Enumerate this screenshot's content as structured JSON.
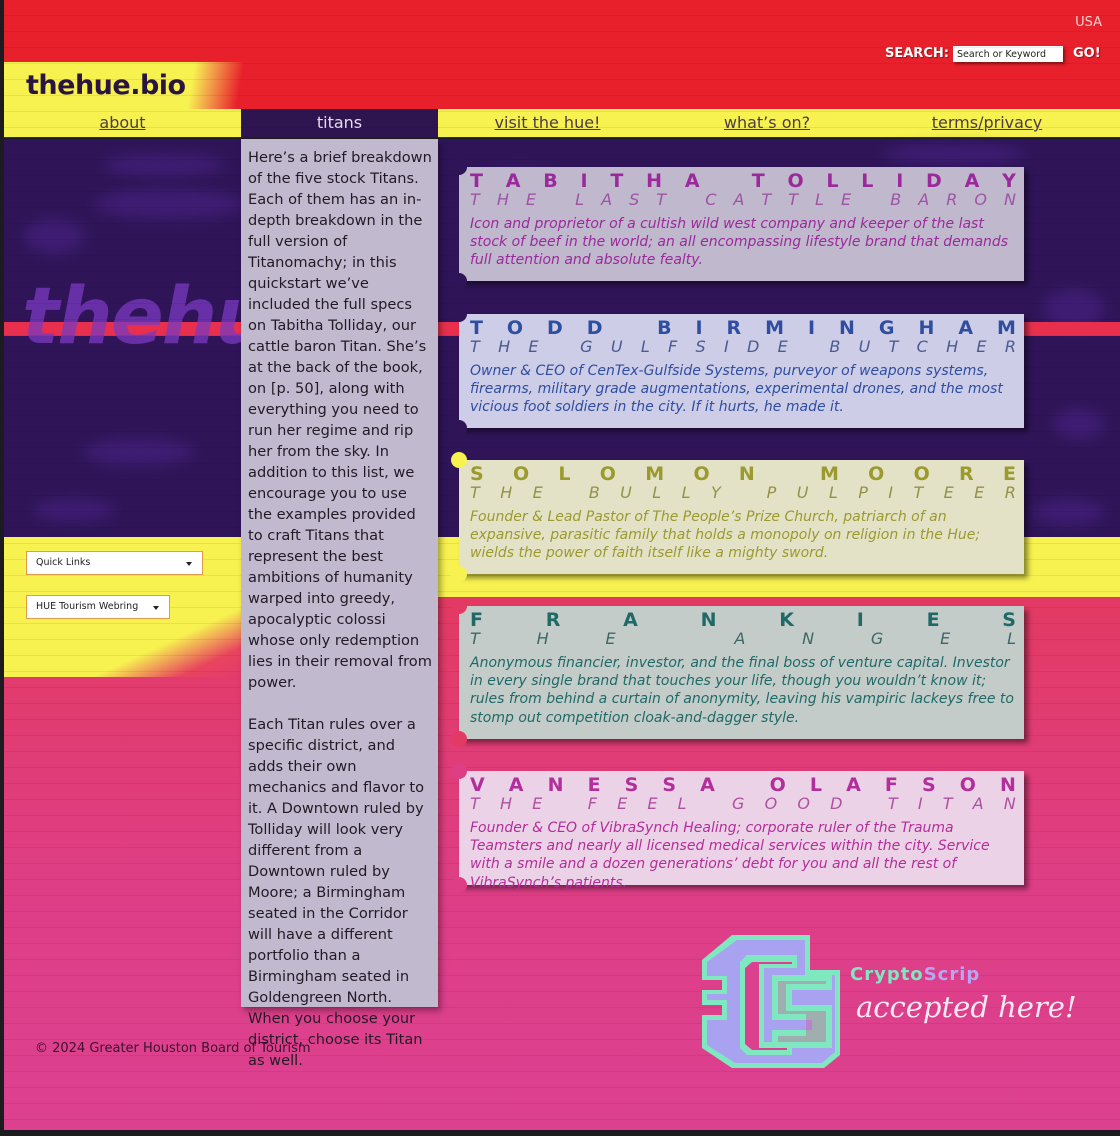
{
  "header": {
    "site_logo": "thehue.bio",
    "region": "USA",
    "search_label": "SEARCH:",
    "search_placeholder": "Search or Keyword",
    "search_value": "",
    "go_label": "GO!"
  },
  "nav": {
    "items": [
      {
        "label": "about",
        "active": false
      },
      {
        "label": "titans",
        "active": true
      },
      {
        "label": "visit the hue!",
        "active": false
      },
      {
        "label": "what’s on?",
        "active": false
      },
      {
        "label": "terms/privacy",
        "active": false
      }
    ]
  },
  "background_watermark": "thehue",
  "sidebar": {
    "quick_links": "Quick Links",
    "webring": "HUE Tourism Webring"
  },
  "intro": {
    "paragraphs": [
      "Here’s a brief breakdown of the five stock Titans. Each of them has an in-depth breakdown in the full version of Titanomachy; in this quickstart we’ve included the full specs on Tabitha Tolliday, our cattle baron Titan. She’s at the back of the book, on [p. 50], along with everything you need to run her regime and rip her from the sky. In addition to this list, we encourage you to use the examples provided to craft Titans that represent the best ambitions of humanity warped into greedy, apocalyptic colossi whose only redemption lies in their removal from power.",
      "Each Titan rules over a specific district, and adds their own mechanics and flavor to it. A Downtown ruled by Tolliday will look very different from a Downtown ruled by Moore; a Birmingham seated in the Corridor will have a different portfolio than a Birmingham seated in Goldengreen North. When you choose your district, choose its Titan as well."
    ]
  },
  "titans": [
    {
      "name": "TABITHA TOLLIDAY",
      "title": "THE LAST CATTLE BARON",
      "description": "Icon and proprietor of a cultish wild west company and keeper of the last stock of beef in the world; an all encompassing lifestyle brand that demands full attention and absolute fealty.",
      "bg": "#c0b8cc",
      "color": "#9a2a9c",
      "title_color": "#9a4aa0"
    },
    {
      "name": "TODD BIRMINGHAM",
      "title": "THE GULFSIDE BUTCHER",
      "description": "Owner & CEO of CenTex-Gulfside Systems, purveyor of weapons systems, firearms, military grade augmentations, experimental drones, and the most vicious foot soldiers in the city. If it hurts, he made it.",
      "bg": "#cdcde8",
      "color": "#2f4ea0",
      "title_color": "#3d4e88"
    },
    {
      "name": "SOLOMON MOORE",
      "title": "THE BULLY PULPITEER",
      "description": "Founder & Lead Pastor of The People’s Prize Church, patriarch of an expansive, parasitic family that holds a monopoly on religion in the Hue; wields the power of faith itself like a mighty sword.",
      "bg": "#e4e2c6",
      "color": "#9a9a2e",
      "title_color": "#8a8a3a"
    },
    {
      "name": "FRANKIES",
      "title": "THE ANGEL",
      "description": "Anonymous financier, investor, and the final boss of venture capital. Investor in every single brand that touches your life, though you wouldn’t know it; rules from behind a curtain of anonymity, leaving his vampiric lackeys free to stomp out competition cloak-and-dagger style.",
      "bg": "#c4ccca",
      "color": "#1f6a66",
      "title_color": "#2f5e5a"
    },
    {
      "name": "VANESSA OLAFSON",
      "title": "THE FEEL GOOD TITAN",
      "description": "Founder & CEO of VibraSynch Healing; corporate ruler of the Trauma Teamsters and nearly all licensed medical services within the city. Service with a smile and a dozen generations’ debt for you and all the rest of VibraSynch’s patients.",
      "bg": "#ecd2e6",
      "color": "#b22e9a",
      "title_color": "#a8449a"
    }
  ],
  "promo": {
    "brand_part1": "Crypto",
    "brand_part2": "Scrip",
    "tagline": "accepted here!"
  },
  "footer": {
    "copyright": "© 2024 Greater Houston Board of Tourism"
  },
  "colors": {
    "header_red": "#e8202b",
    "nav_yellow": "#f7f250",
    "active_tab": "#2e1550",
    "purple_band": "#2f1558",
    "pink_band": "#de3e86",
    "cs_mint": "#7fe8c0",
    "cs_lavender": "#b8a6f4"
  }
}
